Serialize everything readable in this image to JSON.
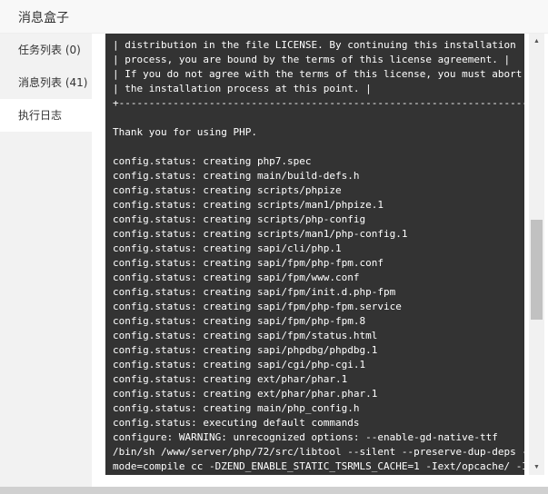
{
  "dialog": {
    "title": "消息盒子"
  },
  "sidebar": {
    "items": [
      {
        "label": "任务列表 (0)"
      },
      {
        "label": "消息列表 (41)"
      },
      {
        "label": "执行日志",
        "active": true
      }
    ]
  },
  "terminal": {
    "text": "| distribution in the file LICENSE. By continuing this installation |\n| process, you are bound by the terms of this license agreement. |\n| If you do not agree with the terms of this license, you must abort |\n| the installation process at this point. |\n+--------------------------------------------------------------------+\n\nThank you for using PHP.\n\nconfig.status: creating php7.spec\nconfig.status: creating main/build-defs.h\nconfig.status: creating scripts/phpize\nconfig.status: creating scripts/man1/phpize.1\nconfig.status: creating scripts/php-config\nconfig.status: creating scripts/man1/php-config.1\nconfig.status: creating sapi/cli/php.1\nconfig.status: creating sapi/fpm/php-fpm.conf\nconfig.status: creating sapi/fpm/www.conf\nconfig.status: creating sapi/fpm/init.d.php-fpm\nconfig.status: creating sapi/fpm/php-fpm.service\nconfig.status: creating sapi/fpm/php-fpm.8\nconfig.status: creating sapi/fpm/status.html\nconfig.status: creating sapi/phpdbg/phpdbg.1\nconfig.status: creating sapi/cgi/php-cgi.1\nconfig.status: creating ext/phar/phar.1\nconfig.status: creating ext/phar/phar.phar.1\nconfig.status: creating main/php_config.h\nconfig.status: executing default commands\nconfigure: WARNING: unrecognized options: --enable-gd-native-ttf\n/bin/sh /www/server/php/72/src/libtool --silent --preserve-dup-deps --\nmode=compile cc -DZEND_ENABLE_STATIC_TSRMLS_CACHE=1 -Iext/opcache/ -I/"
  },
  "scrollbar": {
    "up_icon": "triangle-up",
    "down_icon": "triangle-down",
    "position_fraction": 0.55
  },
  "colors": {
    "terminal_bg": "#333333",
    "terminal_fg": "#ffffff",
    "sidebar_bg": "#f2f2f2"
  }
}
